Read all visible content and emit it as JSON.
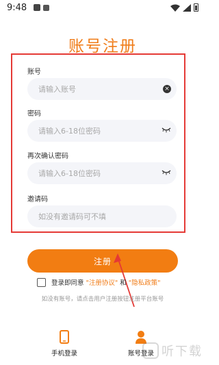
{
  "status_bar": {
    "time": "9:48"
  },
  "title": "账号注册",
  "form": {
    "account": {
      "label": "账号",
      "placeholder": "请输入账号"
    },
    "password": {
      "label": "密码",
      "placeholder": "请输入6-18位密码"
    },
    "confirm_password": {
      "label": "再次确认密码",
      "placeholder": "请输入6-18位密码"
    },
    "invite_code": {
      "label": "邀请码",
      "placeholder": "如没有邀请码可不填"
    }
  },
  "submit_label": "注册",
  "agreement": {
    "prefix": "登录即同意",
    "terms_link": "\"注册协议\"",
    "and": "和",
    "privacy_link": "\"隐私政策\""
  },
  "hint": "如没有账号，请点击用户注册按钮注册平台账号",
  "bottom_tabs": [
    {
      "label": "手机登录",
      "icon": "phone-icon"
    },
    {
      "label": "账号登录",
      "icon": "user-icon"
    }
  ],
  "watermark": {
    "text": "听下载"
  },
  "colors": {
    "accent": "#f27d12",
    "annotation": "#e53935"
  }
}
